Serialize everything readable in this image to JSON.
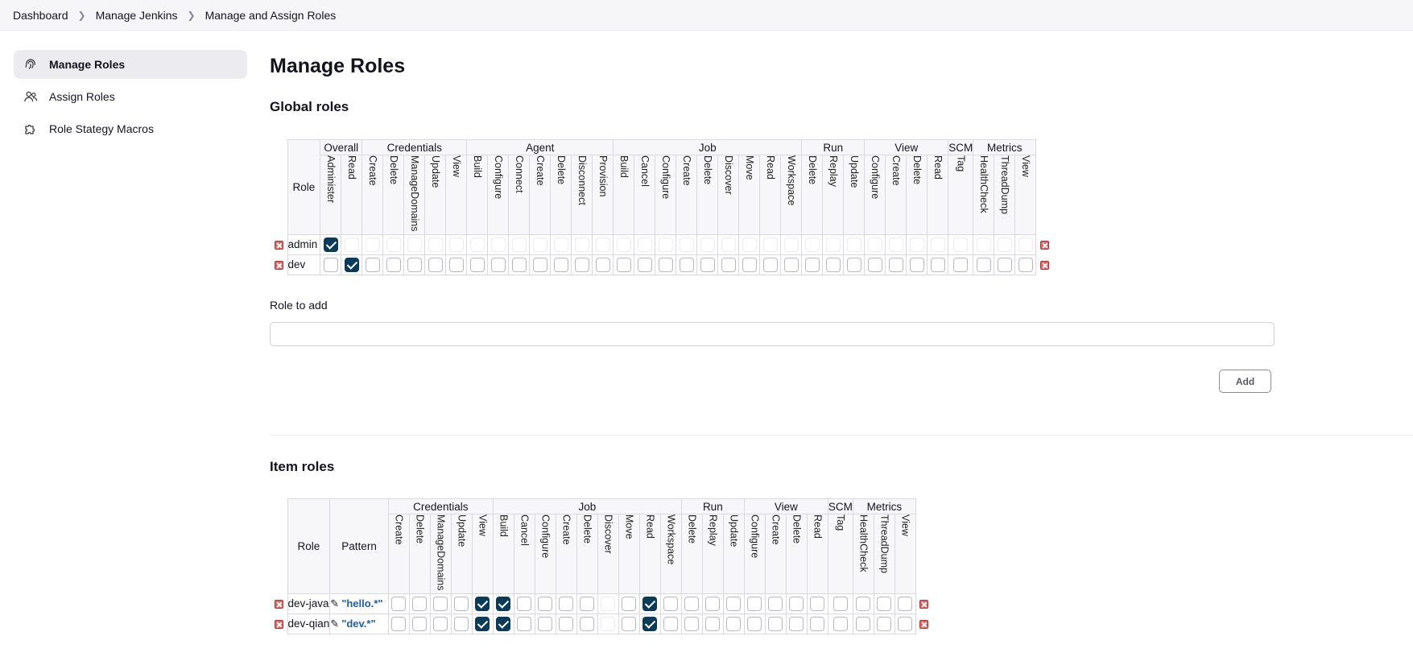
{
  "breadcrumb": [
    "Dashboard",
    "Manage Jenkins",
    "Manage and Assign Roles"
  ],
  "sidebar": {
    "items": [
      {
        "label": "Manage Roles",
        "icon": "fingerprint-icon",
        "active": true
      },
      {
        "label": "Assign Roles",
        "icon": "users-icon",
        "active": false
      },
      {
        "label": "Role Stategy Macros",
        "icon": "puzzle-icon",
        "active": false
      }
    ]
  },
  "page_title": "Manage Roles",
  "global": {
    "heading": "Global roles",
    "role_header": "Role",
    "groups": [
      {
        "name": "Overall",
        "perms": [
          "Administer",
          "Read"
        ]
      },
      {
        "name": "Credentials",
        "perms": [
          "Create",
          "Delete",
          "ManageDomains",
          "Update",
          "View"
        ]
      },
      {
        "name": "Agent",
        "perms": [
          "Build",
          "Configure",
          "Connect",
          "Create",
          "Delete",
          "Disconnect",
          "Provision"
        ]
      },
      {
        "name": "Job",
        "perms": [
          "Build",
          "Cancel",
          "Configure",
          "Create",
          "Delete",
          "Discover",
          "Move",
          "Read",
          "Workspace"
        ]
      },
      {
        "name": "Run",
        "perms": [
          "Delete",
          "Replay",
          "Update"
        ]
      },
      {
        "name": "View",
        "perms": [
          "Configure",
          "Create",
          "Delete",
          "Read"
        ]
      },
      {
        "name": "SCM",
        "perms": [
          "Tag"
        ]
      },
      {
        "name": "Metrics",
        "perms": [
          "HealthCheck",
          "ThreadDump",
          "View"
        ]
      }
    ],
    "rows": [
      {
        "name": "admin",
        "checked": [
          0
        ],
        "faint_all": true
      },
      {
        "name": "dev",
        "checked": [
          1
        ],
        "faint_all": false
      }
    ],
    "add_label": "Role to add",
    "add_value": "",
    "add_button": "Add"
  },
  "item": {
    "heading": "Item roles",
    "role_header": "Role",
    "pattern_header": "Pattern",
    "groups": [
      {
        "name": "Credentials",
        "perms": [
          "Create",
          "Delete",
          "ManageDomains",
          "Update",
          "View"
        ]
      },
      {
        "name": "Job",
        "perms": [
          "Build",
          "Cancel",
          "Configure",
          "Create",
          "Delete",
          "Discover",
          "Move",
          "Read",
          "Workspace"
        ]
      },
      {
        "name": "Run",
        "perms": [
          "Delete",
          "Replay",
          "Update"
        ]
      },
      {
        "name": "View",
        "perms": [
          "Configure",
          "Create",
          "Delete",
          "Read"
        ]
      },
      {
        "name": "SCM",
        "perms": [
          "Tag"
        ]
      },
      {
        "name": "Metrics",
        "perms": [
          "HealthCheck",
          "ThreadDump",
          "View"
        ]
      }
    ],
    "rows": [
      {
        "name": "dev-java",
        "pattern": "\"hello.*\"",
        "checked": [
          4,
          5,
          12
        ],
        "faint": [
          10
        ]
      },
      {
        "name": "dev-qian",
        "pattern": "\"dev.*\"",
        "checked": [
          4,
          5,
          12
        ],
        "faint": [
          10
        ]
      }
    ]
  },
  "colors": {
    "checked": "#0b3b5a",
    "pattern": "#1f5fa8",
    "delete": "#e06464"
  }
}
